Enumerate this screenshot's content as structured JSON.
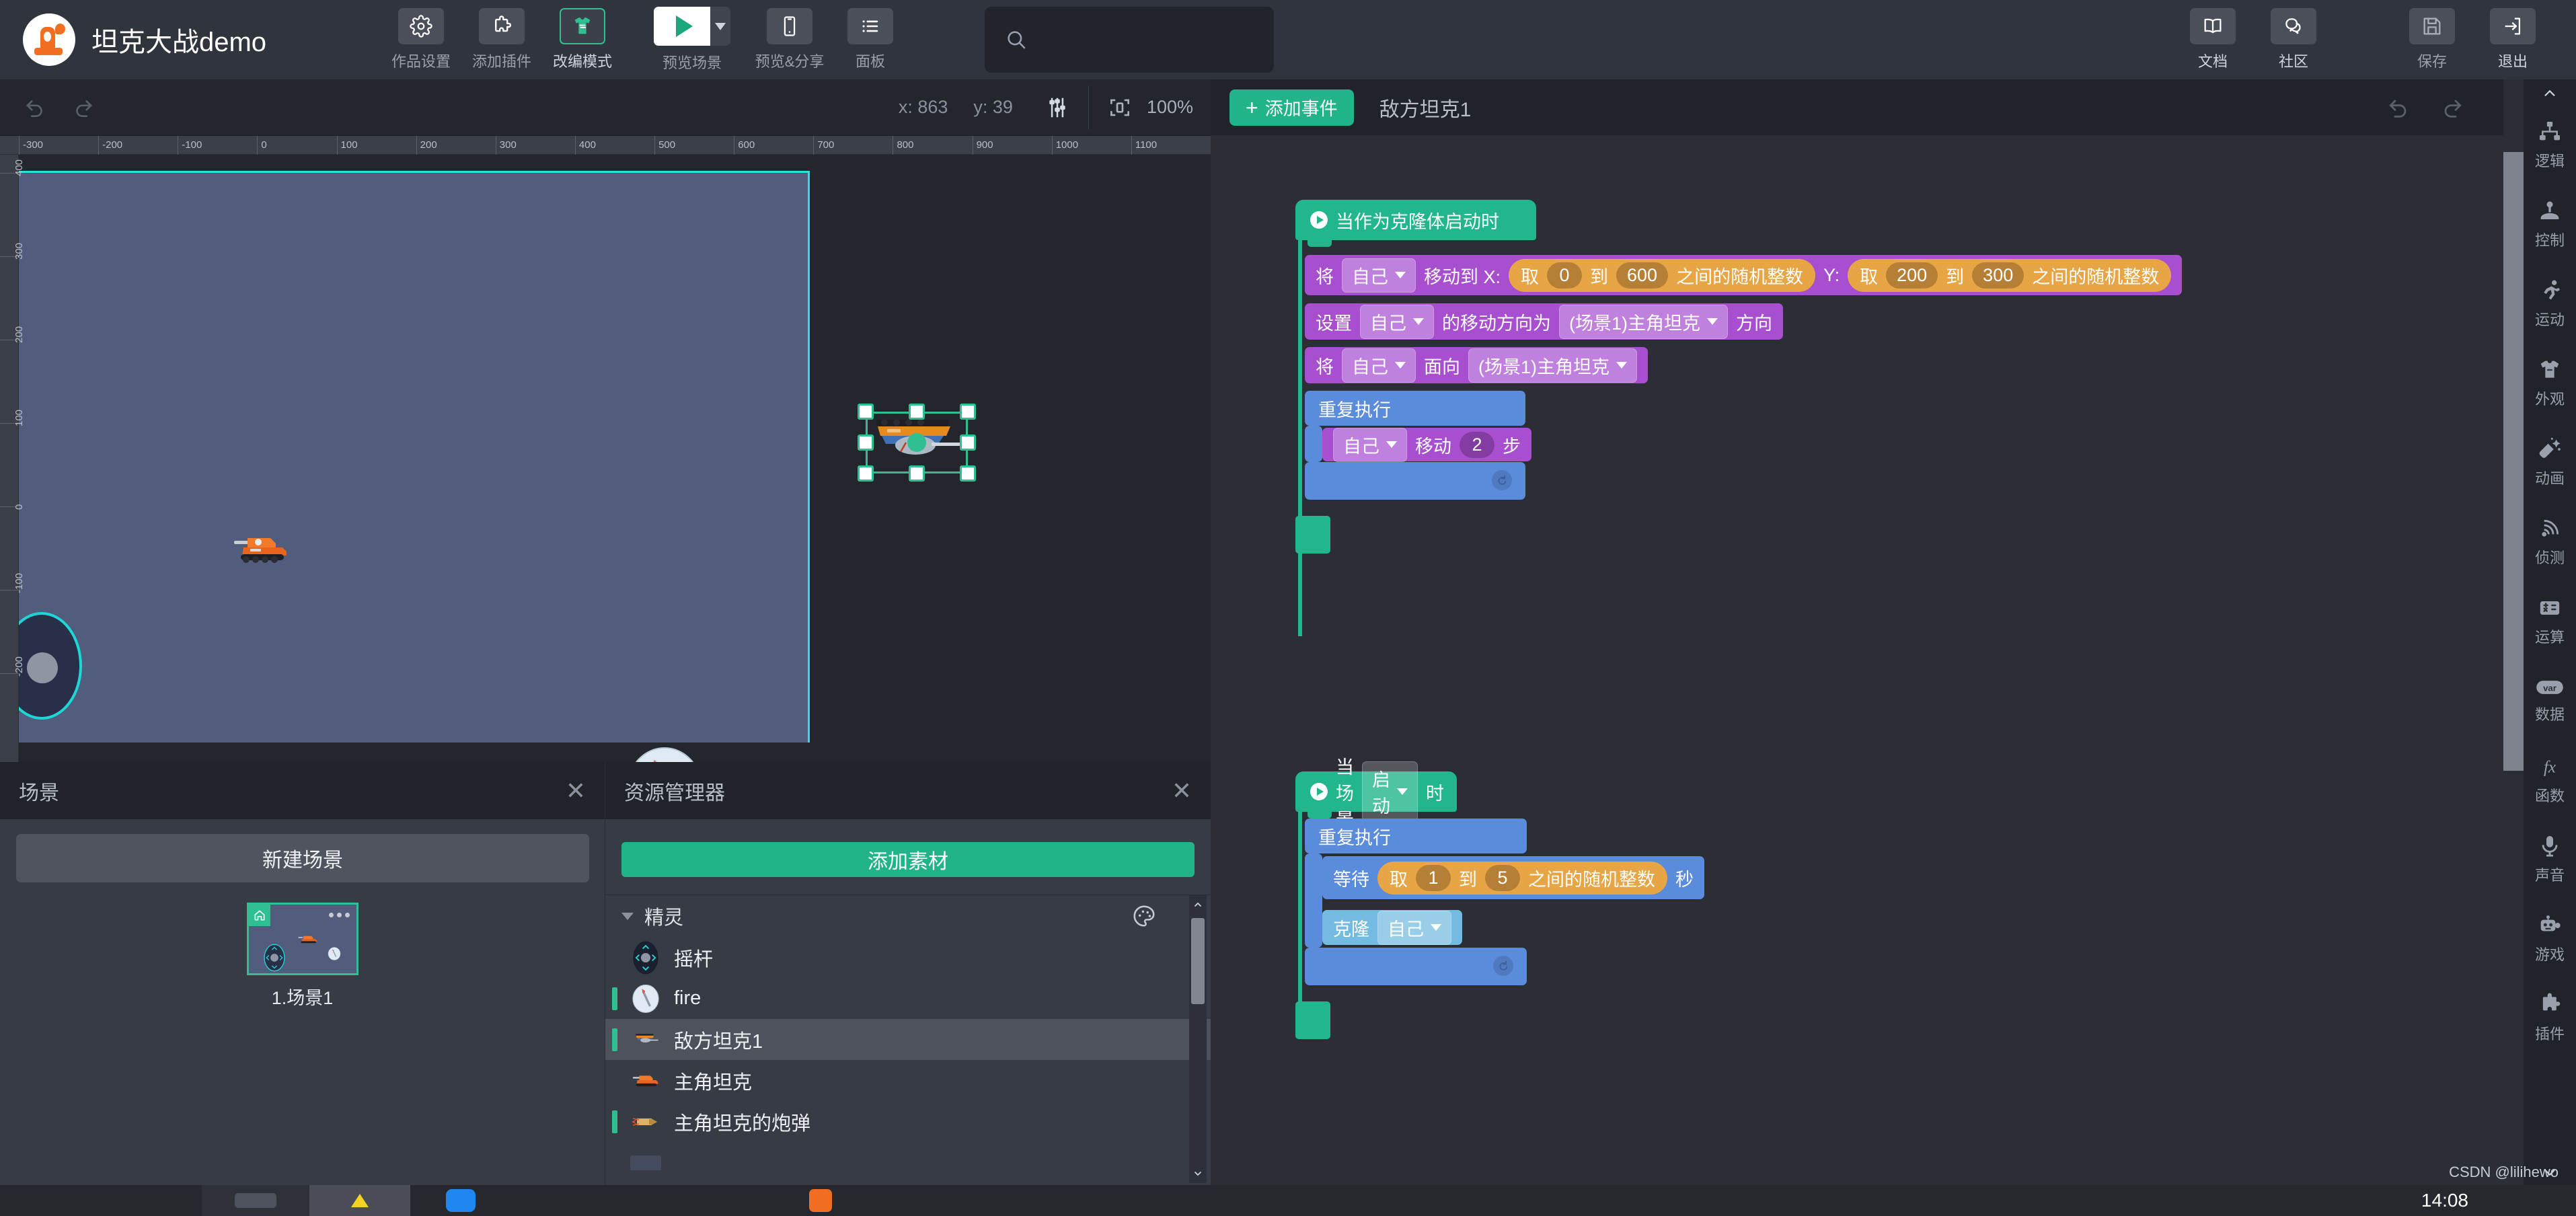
{
  "app": {
    "title": "坦克大战demo",
    "logo_icon": "codemao-logo-icon"
  },
  "toolbar": {
    "left_tools": [
      {
        "label": "作品设置",
        "icon": "gear-icon",
        "active": false
      },
      {
        "label": "添加插件",
        "icon": "puzzle-icon",
        "active": false
      },
      {
        "label": "改编模式",
        "icon": "tshirt-swap-icon",
        "active": true
      }
    ],
    "play": {
      "label": "预览场景",
      "icon": "play-triangle-icon",
      "dropdown_icon": "chevron-down-icon"
    },
    "mid_tools": [
      {
        "label": "预览&分享",
        "icon": "phone-icon"
      },
      {
        "label": "面板",
        "icon": "list-icon"
      }
    ],
    "search": {
      "placeholder": "",
      "value": "",
      "icon": "search-icon"
    },
    "right_tools": [
      {
        "label": "文档",
        "icon": "book-icon"
      },
      {
        "label": "社区",
        "icon": "chat-bubbles-icon"
      },
      {
        "label": "保存",
        "icon": "floppy-save-icon"
      },
      {
        "label": "退出",
        "icon": "exit-arrow-icon"
      }
    ]
  },
  "stage": {
    "undo_icon": "undo-arrow-icon",
    "redo_icon": "redo-arrow-icon",
    "cursor_x_label": "x: 863",
    "cursor_y_label": "y: 39",
    "settings_icon": "sliders-icon",
    "fit_icon": "fit-screen-icon",
    "zoom_label": "100%",
    "ruler_x_ticks": [
      "-300",
      "-200",
      "-100",
      "0",
      "100",
      "200",
      "300",
      "400",
      "500",
      "600",
      "700",
      "800",
      "900",
      "1000",
      "1100"
    ],
    "ruler_y_ticks": [
      "400",
      "300",
      "200",
      "100",
      "0",
      "-100",
      "-200"
    ],
    "sprites": [
      {
        "name": "主角坦克",
        "icon": "orange-tank-icon"
      },
      {
        "name": "摇杆",
        "icon": "joystick-icon"
      },
      {
        "name": "fire",
        "icon": "fire-button-icon"
      },
      {
        "name": "敌方坦克1",
        "icon": "enemy-tank-icon",
        "selected": true
      }
    ]
  },
  "scene_panel": {
    "title": "场景",
    "close_icon": "close-icon",
    "new_scene_label": "新建场景",
    "scenes": [
      {
        "name": "1.场景1",
        "home_icon": "home-icon",
        "more_icon": "more-dots-icon",
        "selected": true
      }
    ]
  },
  "resource_panel": {
    "title": "资源管理器",
    "close_icon": "close-icon",
    "add_asset_label": "添加素材",
    "palette_icon": "palette-icon",
    "groups": [
      {
        "name": "精灵",
        "caret_icon": "caret-down-icon",
        "items": [
          {
            "label": "摇杆",
            "icon": "joystick-icon",
            "marked": false,
            "selected": false
          },
          {
            "label": "fire",
            "icon": "fire-button-icon",
            "marked": true,
            "selected": false
          },
          {
            "label": "敌方坦克1",
            "icon": "enemy-tank-icon",
            "marked": true,
            "selected": true
          },
          {
            "label": "主角坦克",
            "icon": "orange-tank-icon",
            "marked": false,
            "selected": false
          },
          {
            "label": "主角坦克的炮弹",
            "icon": "shell-icon",
            "marked": true,
            "selected": false
          }
        ]
      }
    ],
    "scroll_up_icon": "chevron-up-icon",
    "scroll_down_icon": "chevron-down-icon"
  },
  "blocks": {
    "add_event_label": "添加事件",
    "add_event_plus": "+",
    "current_sprite": "敌方坦克1",
    "undo_icon": "undo-arrow-icon",
    "redo_icon": "redo-arrow-icon",
    "script1": {
      "hat": "当作为克隆体启动时",
      "b1": {
        "pre": "将",
        "target": "自己",
        "mid": "移动到 X:",
        "rx": {
          "pre": "取",
          "from": "0",
          "mid": "到",
          "to": "600",
          "post": "之间的随机整数"
        },
        "ylabel": "Y:",
        "ry": {
          "pre": "取",
          "from": "200",
          "mid": "到",
          "to": "300",
          "post": "之间的随机整数"
        }
      },
      "b2": {
        "pre": "设置",
        "target": "自己",
        "mid": "的移动方向为",
        "ref": "(场景1)主角坦克",
        "post": "方向"
      },
      "b3": {
        "pre": "将",
        "target": "自己",
        "mid": "面向",
        "ref": "(场景1)主角坦克"
      },
      "b4": {
        "label": "重复执行",
        "loop_icon": "loop-arrow-icon"
      },
      "b5": {
        "target": "自己",
        "mid": "移动",
        "steps": "2",
        "post": "步"
      }
    },
    "script2": {
      "hat_pre": "当场景",
      "hat_drop": "启动",
      "hat_post": "时",
      "b1": {
        "label": "重复执行",
        "loop_icon": "loop-arrow-icon"
      },
      "b2": {
        "pre": "等待",
        "r": {
          "pre": "取",
          "from": "1",
          "mid": "到",
          "to": "5",
          "post": "之间的随机整数"
        },
        "post": "秒"
      },
      "b3": {
        "pre": "克隆",
        "target": "自己"
      }
    }
  },
  "categories": {
    "scroll_up_icon": "chevron-up-icon",
    "scroll_down_icon": "chevron-down-icon",
    "items": [
      {
        "label": "逻辑",
        "icon": "hierarchy-icon"
      },
      {
        "label": "控制",
        "icon": "joystick-control-icon"
      },
      {
        "label": "运动",
        "icon": "runner-icon"
      },
      {
        "label": "外观",
        "icon": "tshirt-icon"
      },
      {
        "label": "动画",
        "icon": "shooting-star-icon"
      },
      {
        "label": "侦测",
        "icon": "radar-icon"
      },
      {
        "label": "运算",
        "icon": "calculator-icon"
      },
      {
        "label": "数据",
        "icon": "var-icon"
      },
      {
        "label": "函数",
        "icon": "fx-icon"
      },
      {
        "label": "声音",
        "icon": "microphone-icon"
      },
      {
        "label": "游戏",
        "icon": "robot-icon"
      },
      {
        "label": "插件",
        "icon": "puzzle-icon"
      }
    ]
  },
  "taskbar": {
    "clock": "14:08",
    "watermark": "CSDN @lilihewo"
  },
  "colors": {
    "accent_green": "#22b489",
    "topbar_bg": "#30343d",
    "panel_bg": "#373b43",
    "stage_bg": "#525c7c",
    "block_purple": "#a84fd0",
    "block_blue": "#5b8bdb",
    "block_lblue": "#73bbe0",
    "block_orange": "#e8a545",
    "cyan_edge": "#22e3e0"
  }
}
